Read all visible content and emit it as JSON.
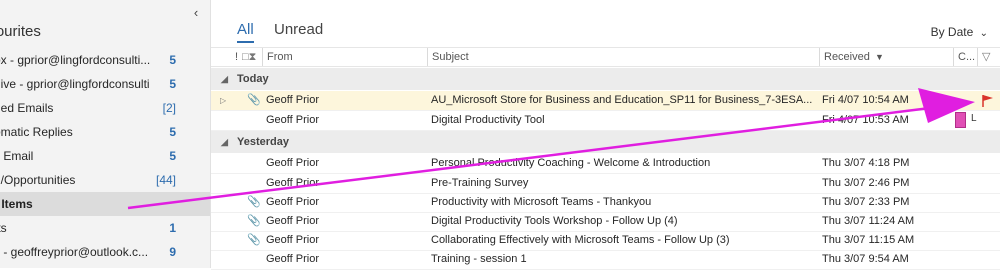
{
  "sidebar": {
    "favourites_label": "avourites",
    "collapse_icon": "chevron-left-icon",
    "folders": [
      {
        "name": "ox - gprior@lingfordconsulti...",
        "count": "5"
      },
      {
        "name": "hive - gprior@lingfordconsultin...",
        "count": "5"
      },
      {
        "name": "ged Emails",
        "count": "[2]"
      },
      {
        "name": "omatic Replies",
        "count": "5"
      },
      {
        "name": "x Email",
        "count": "5"
      },
      {
        "name": "d/Opportunities",
        "count": "[44]"
      },
      {
        "name": "t Items",
        "count": ""
      },
      {
        "name": "fts",
        "count": "1"
      },
      {
        "name": "x - geoffreyprior@outlook.c...",
        "count": "9"
      }
    ]
  },
  "tabs": [
    {
      "label": "All"
    },
    {
      "label": "Unread"
    }
  ],
  "sort": {
    "label": "By Date",
    "icon": "chevron-down-icon"
  },
  "columns": {
    "icons": "!",
    "from": "From",
    "subject": "Subject",
    "received": "Received",
    "category": "C...",
    "flag_icon": "filter-icon"
  },
  "groups": [
    {
      "label": "Today",
      "rows": [
        {
          "from": "Geoff Prior",
          "subject": "AU_Microsoft Store for Business and Education_SP11 for Business_7-3ESA...",
          "received": "Fri 4/07 10:54 AM",
          "attachment": true,
          "expand": true
        },
        {
          "from": "Geoff Prior",
          "subject": "Digital Productivity Tool",
          "received": "Fri 4/07 10:53 AM",
          "attachment": false,
          "expand": false
        }
      ]
    },
    {
      "label": "Yesterday",
      "rows": [
        {
          "from": "Geoff Prior",
          "subject": "Personal Productivity Coaching - Welcome & Introduction",
          "received": "Thu 3/07 4:18 PM",
          "attachment": false
        },
        {
          "from": "Geoff Prior",
          "subject": "Pre-Training Survey",
          "received": "Thu 3/07 2:46 PM",
          "attachment": false
        },
        {
          "from": "Geoff Prior",
          "subject": "Productivity with Microsoft Teams - Thankyou",
          "received": "Thu 3/07 2:33 PM",
          "attachment": true
        },
        {
          "from": "Geoff Prior",
          "subject": "Digital Productivity Tools Workshop - Follow Up (4)",
          "received": "Thu 3/07 11:24 AM",
          "attachment": true
        },
        {
          "from": "Geoff Prior",
          "subject": "Collaborating Effectively with Microsoft Teams - Follow Up (3)",
          "received": "Thu 3/07 11:15 AM",
          "attachment": true
        },
        {
          "from": "Geoff Prior",
          "subject": "Training - session 1",
          "received": "Thu 3/07 9:54 AM",
          "attachment": false
        }
      ]
    }
  ],
  "category_letter": "L",
  "colors": {
    "accent": "#2d6cae",
    "annotation": "#e01ee0",
    "category": "#e04fb5",
    "flag": "#d9342b"
  }
}
